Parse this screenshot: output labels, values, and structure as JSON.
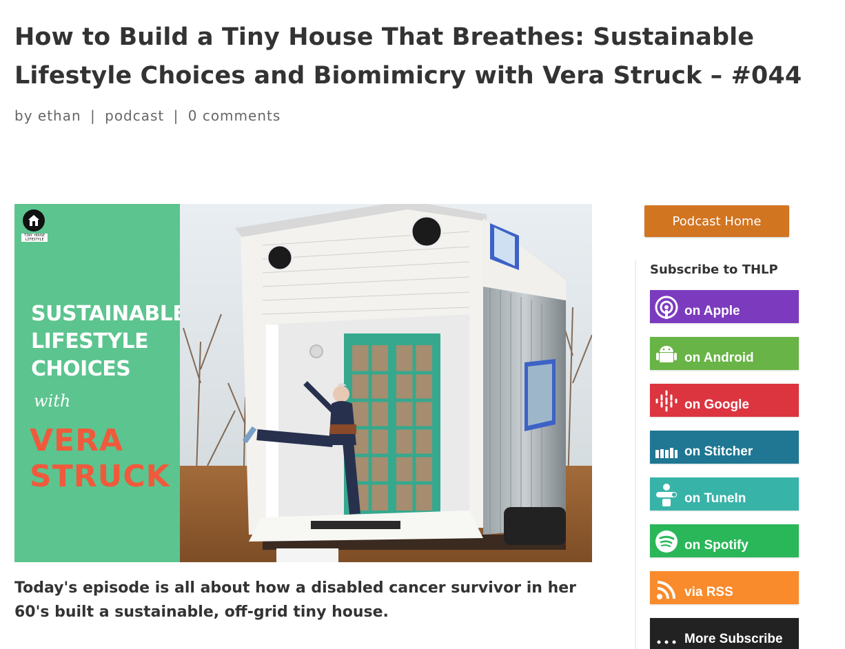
{
  "post": {
    "title": "How to Build a Tiny House That Breathes: Sustainable Lifestyle Choices and Biomimicry with Vera Struck – #044",
    "meta": {
      "prefix": "by",
      "author": "ethan",
      "separator": "|",
      "category": "podcast",
      "comments": "0 comments"
    },
    "featured_image": {
      "logo_text": "TINY HOUSE LIFESTYLE",
      "headline": "SUSTAINABLE LIFESTYLE CHOICES",
      "with": "with",
      "guest": "VERA STRUCK"
    },
    "lead": "Today's episode is all about how a disabled cancer survivor in her 60's built a sustainable, off-grid tiny house."
  },
  "sidebar": {
    "podcast_home_label": "Podcast Home",
    "subscribe_heading": "Subscribe to THLP",
    "subscribe_buttons": [
      {
        "label": "on Apple",
        "icon": "podcast-icon",
        "color": "#7c3bbf"
      },
      {
        "label": "on Android",
        "icon": "android-icon",
        "color": "#68b446"
      },
      {
        "label": "on Google",
        "icon": "google-podcasts-icon",
        "color": "#dc3540"
      },
      {
        "label": "on Stitcher",
        "icon": "stitcher-icon",
        "color": "#1f7793"
      },
      {
        "label": "on TuneIn",
        "icon": "tunein-icon",
        "color": "#38b3a8"
      },
      {
        "label": "on Spotify",
        "icon": "spotify-icon",
        "color": "#2ab759"
      },
      {
        "label": "via RSS",
        "icon": "rss-icon",
        "color": "#f98b2c"
      },
      {
        "label": "More Subscribe",
        "icon": "more-dots-icon",
        "color": "#222222"
      }
    ]
  }
}
